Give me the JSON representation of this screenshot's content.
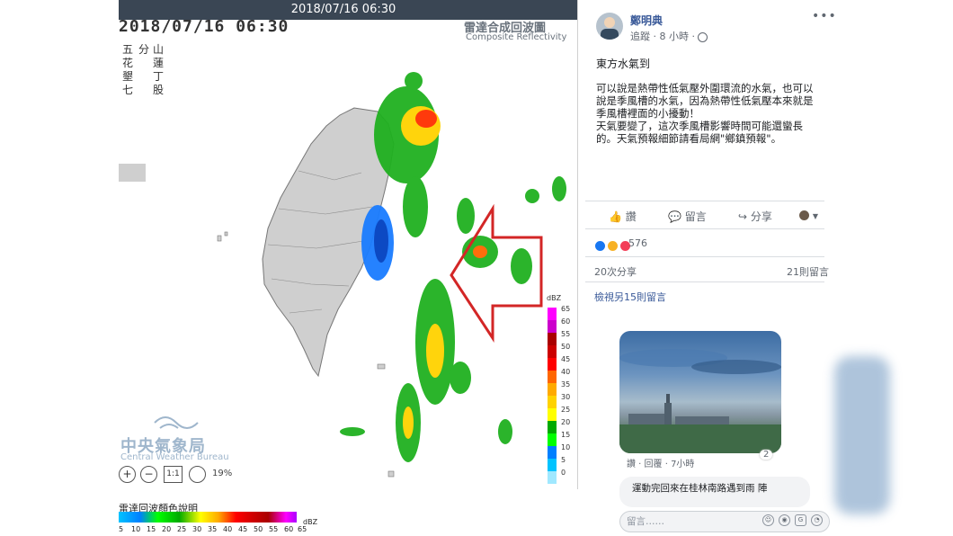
{
  "radar": {
    "banner_time": "2018/07/16 06:30",
    "timestamp": "2018/07/16  06:30",
    "title_zh": "雷達合成回波圖",
    "title_en": "Composite Reflectivity",
    "station_labels": [
      "五",
      "分",
      "山",
      "花",
      "蓮",
      "丁",
      "墾",
      "七",
      "股"
    ],
    "scale_title": "dBZ",
    "scale_ticks": [
      "65",
      "60",
      "55",
      "50",
      "45",
      "40",
      "35",
      "30",
      "25",
      "20",
      "15",
      "10",
      "5",
      "0"
    ],
    "scale_colors": [
      "#ff00ff",
      "#cc00cc",
      "#aa0000",
      "#cc0000",
      "#ff0000",
      "#ff6600",
      "#ffaa00",
      "#ffd200",
      "#ffff00",
      "#00aa00",
      "#00ff00",
      "#0080ff",
      "#00c3ff",
      "#a0e8ff"
    ],
    "agency_zh": "中央氣象局",
    "agency_en": "Central Weather Bureau",
    "zoom_ratio_label": "1:1",
    "zoom_percent": "19%"
  },
  "legend": {
    "title": "雷達回波顏色說明",
    "unit": "dBZ",
    "ticks": [
      "5",
      "10",
      "15",
      "20",
      "25",
      "30",
      "35",
      "40",
      "45",
      "50",
      "55",
      "60",
      "65"
    ]
  },
  "post": {
    "author": "鄭明典",
    "meta": "追蹤 · 8 小時 · ",
    "more": "•••",
    "title": "東方水氣到",
    "body": "可以說是熱帶性低氣壓外圍環流的水氣，也可以說是季風槽的水氣，因為熱帶性低氣壓本來就是季風槽裡面的小擾動！\n天氣要變了，這次季風槽影響時間可能還蠻長的。天氣預報細節請看局網\"鄉鎮預報\"。",
    "actions": {
      "like": "讚",
      "comment": "留言",
      "share": "分享"
    },
    "reaction_count": "576",
    "shares": "20次分享",
    "comments": "21則留言",
    "view_more": "檢視另15則留言",
    "photo_likes": "2",
    "photo_actions": "讚 · 回覆 · 7小時",
    "comment_text": "運動完回來在桂林南路遇到雨 陣",
    "comment_placeholder": "留言……",
    "accent": "#385898"
  }
}
